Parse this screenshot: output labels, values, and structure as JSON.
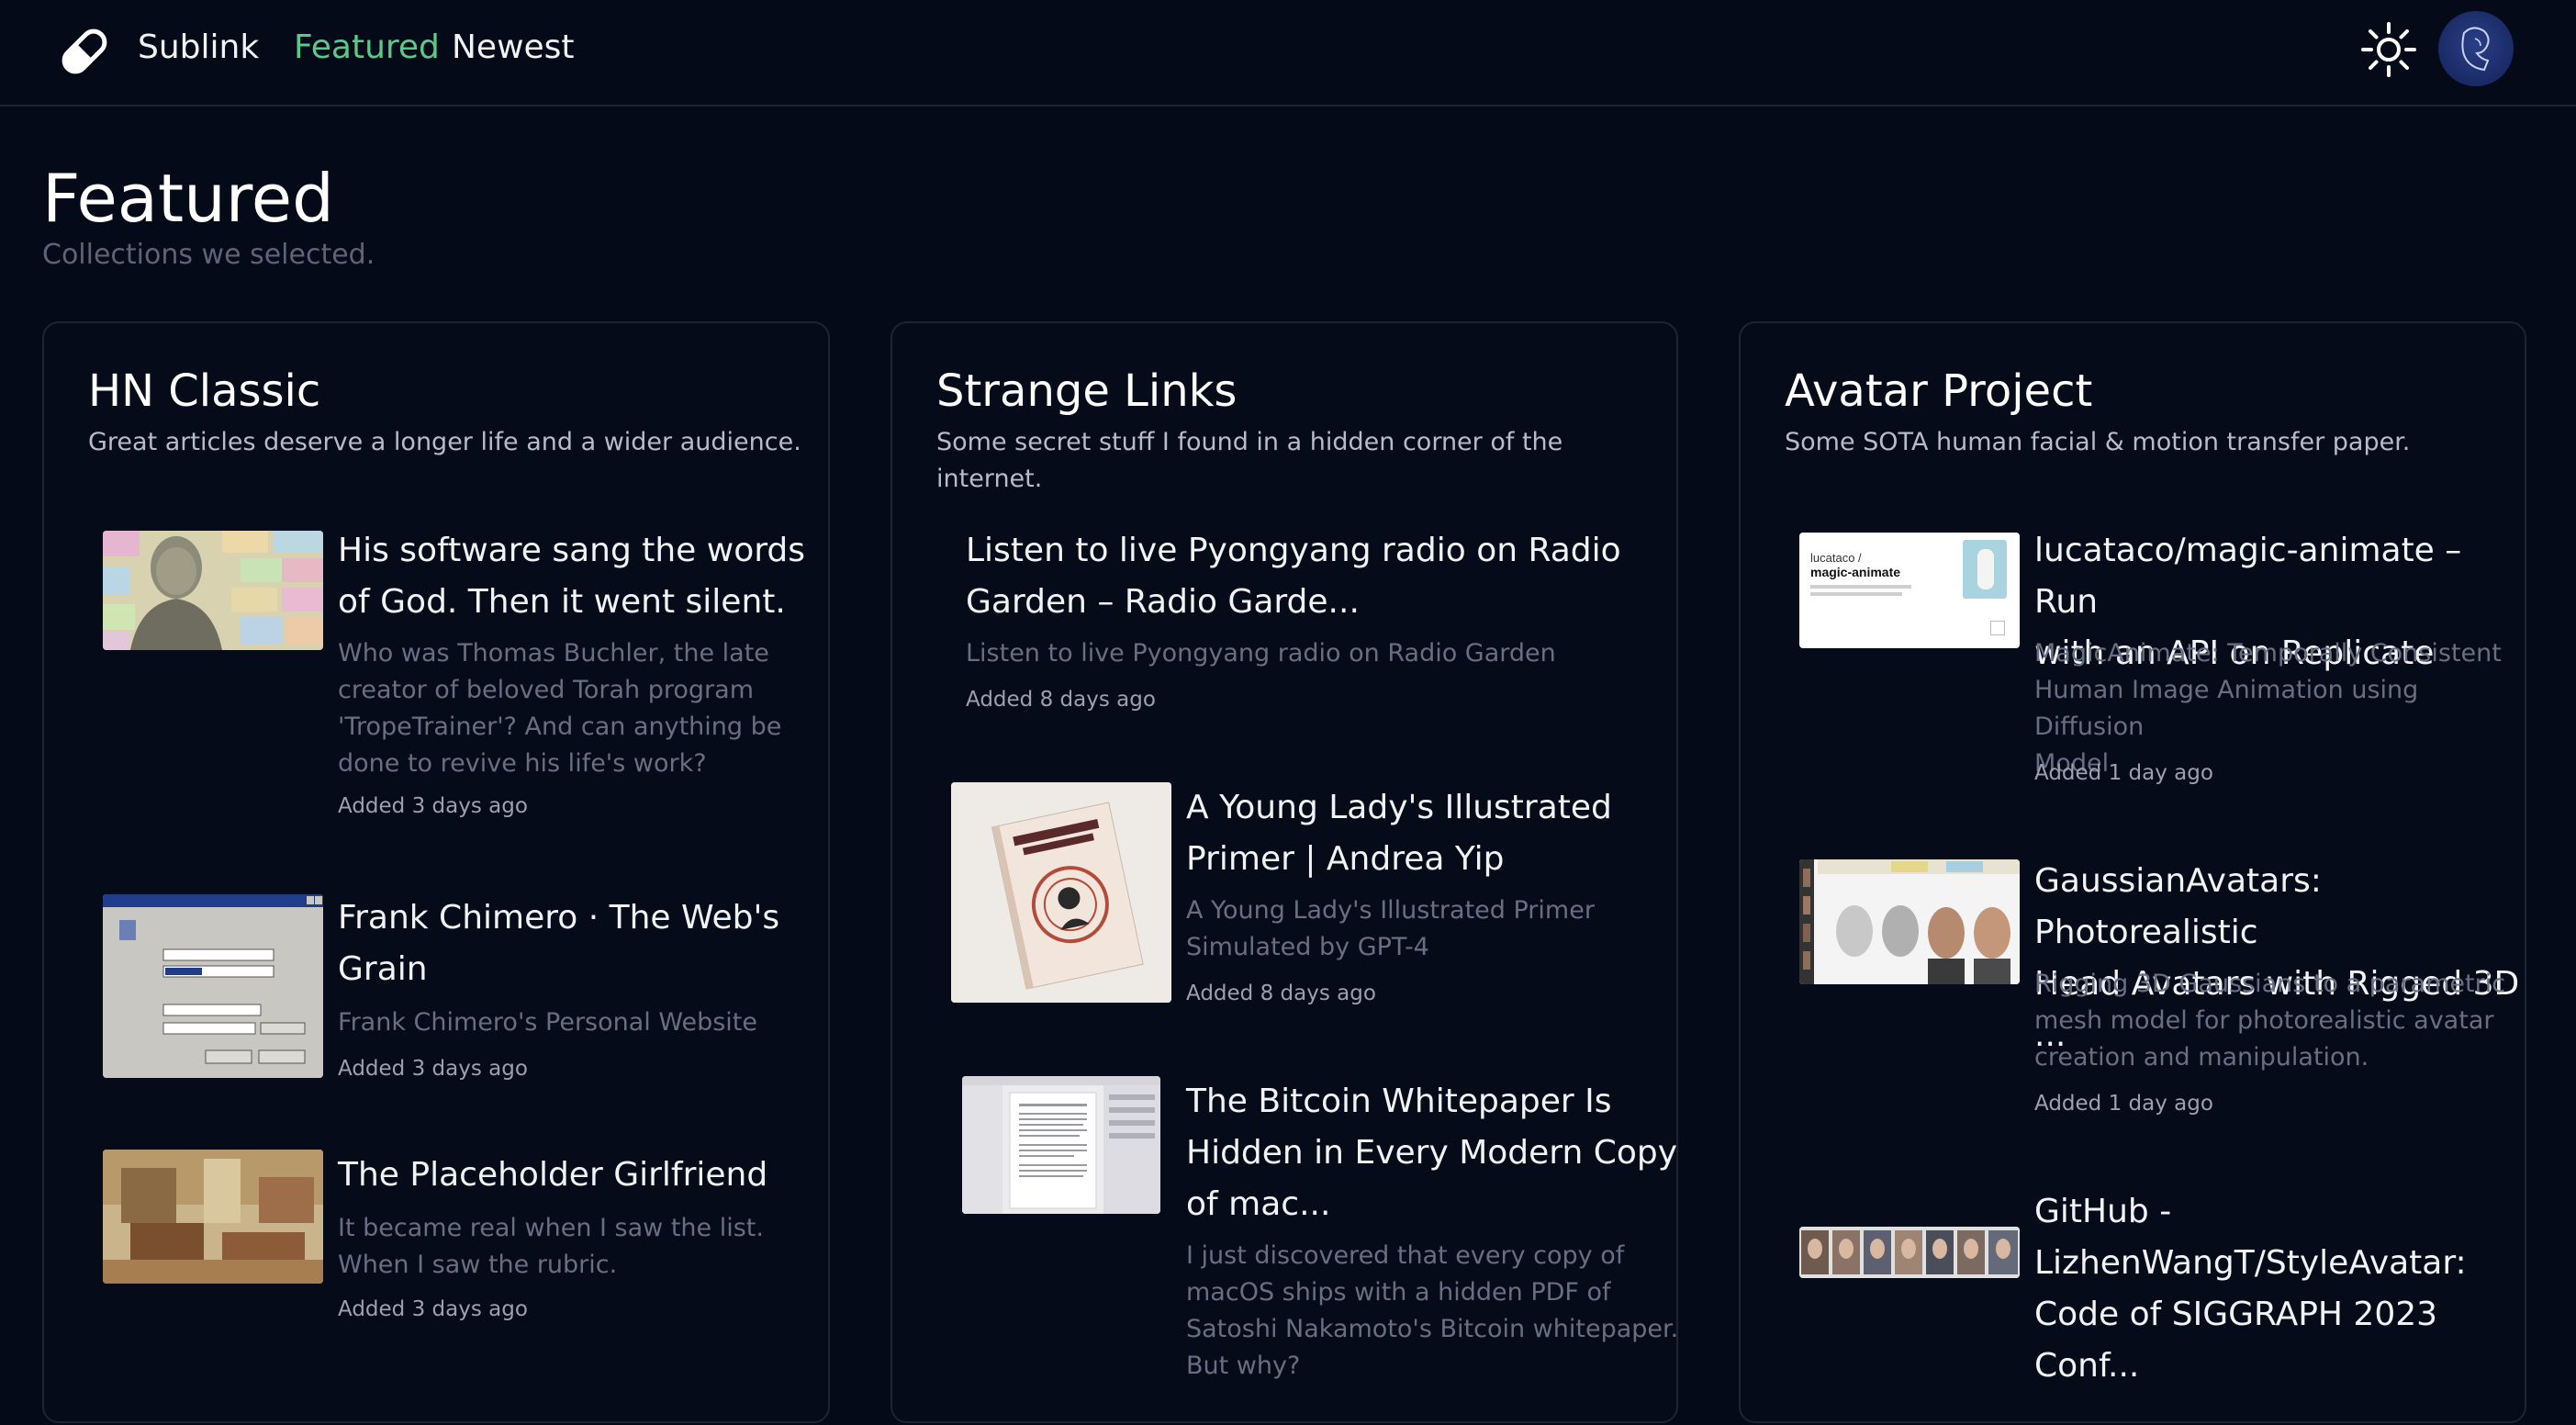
{
  "nav": {
    "brand": "Sublink",
    "links": [
      "Featured",
      "Newest"
    ]
  },
  "page": {
    "title": "Featured",
    "subtitle": "Collections we selected."
  },
  "colors": {
    "background": "#050a18",
    "accent_green": "#5cc98a",
    "border": "#1e2433"
  },
  "icons": {
    "logo": "pill-icon",
    "theme_toggle": "sun-icon",
    "profile": "avatar"
  },
  "collections": [
    {
      "title": "HN Classic",
      "description": "Great articles deserve a longer life and a wider audience.",
      "items": [
        {
          "title_lines": [
            "His software sang the words",
            "of God. Then it went silent."
          ],
          "desc_lines": [
            "Who was Thomas Buchler, the late",
            "creator of beloved Torah program",
            "'TropeTrainer'? And can anything be",
            "done to revive his life's work?"
          ],
          "date": "Added 3 days ago"
        },
        {
          "title_lines": [
            "Frank Chimero · The Web's",
            "Grain"
          ],
          "desc_lines": [
            "Frank Chimero's Personal Website"
          ],
          "date": "Added 3 days ago"
        },
        {
          "title_lines": [
            "The Placeholder Girlfriend"
          ],
          "desc_lines": [
            "It became real when I saw the list.",
            "When I saw the rubric."
          ],
          "date": "Added 3 days ago"
        }
      ]
    },
    {
      "title": "Strange Links",
      "description": "Some secret stuff I found in a hidden corner of the internet.",
      "items": [
        {
          "title_lines": [
            "Listen to live Pyongyang radio on Radio",
            "Garden – Radio Garde..."
          ],
          "desc_lines": [
            "Listen to live Pyongyang radio on Radio Garden"
          ],
          "date": "Added 8 days ago"
        },
        {
          "title_lines": [
            "A Young Lady's Illustrated",
            "Primer | Andrea Yip"
          ],
          "desc_lines": [
            "A Young Lady's Illustrated Primer",
            "Simulated by GPT-4"
          ],
          "date": "Added 8 days ago"
        },
        {
          "title_lines": [
            "The Bitcoin Whitepaper Is",
            "Hidden in Every Modern Copy",
            "of mac..."
          ],
          "desc_lines": [
            "I just discovered that every copy of",
            "macOS ships with a hidden PDF of",
            "Satoshi Nakamoto's Bitcoin whitepaper.",
            "But why?"
          ],
          "date": ""
        }
      ]
    },
    {
      "title": "Avatar Project",
      "description": "Some SOTA human facial & motion transfer paper.",
      "items": [
        {
          "title_lines": [
            "lucataco/magic-animate – Run",
            "with an API on Replicate"
          ],
          "desc_lines": [
            "MagicAnimate: Temporally Consistent",
            "Human Image Animation using Diffusion",
            "Model"
          ],
          "date": "Added 1 day ago",
          "thumb_text": [
            "lucataco /",
            "magic-animate"
          ]
        },
        {
          "title_lines": [
            "GaussianAvatars: Photorealistic",
            "Head Avatars with Rigged 3D ..."
          ],
          "desc_lines": [
            "Rigging 3D Gaussians to a parametric",
            "mesh model for photorealistic avatar",
            "creation and manipulation."
          ],
          "date": "Added 1 day ago"
        },
        {
          "title_lines": [
            "GitHub -",
            "LizhenWangT/StyleAvatar:",
            "Code of SIGGRAPH 2023",
            "Conf..."
          ],
          "desc_lines": [],
          "date": ""
        }
      ]
    }
  ]
}
